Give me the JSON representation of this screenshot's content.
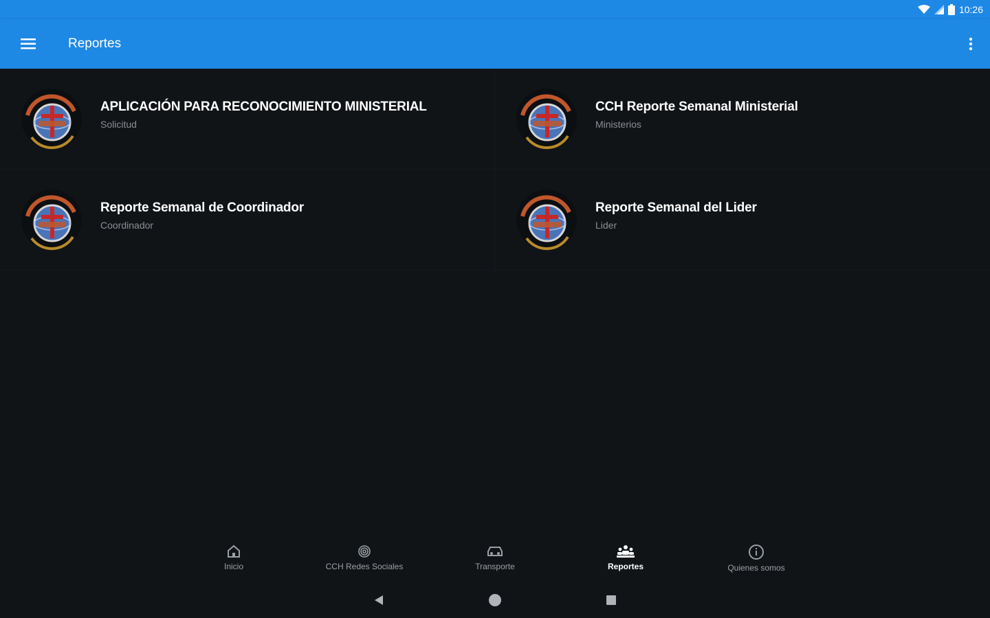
{
  "status_bar": {
    "time": "10:26"
  },
  "app_bar": {
    "title": "Reportes"
  },
  "cards": [
    {
      "title": "APLICACIÓN PARA RECONOCIMIENTO MINISTERIAL",
      "subtitle": "Solicitud"
    },
    {
      "title": "CCH Reporte Semanal Ministerial",
      "subtitle": "Ministerios"
    },
    {
      "title": "Reporte Semanal de Coordinador",
      "subtitle": "Coordinador"
    },
    {
      "title": "Reporte Semanal del Lider",
      "subtitle": "Lider"
    }
  ],
  "bottom_nav": [
    {
      "label": "Inicio",
      "icon": "home-icon"
    },
    {
      "label": "CCH Redes Sociales",
      "icon": "fingerprint-icon"
    },
    {
      "label": "Transporte",
      "icon": "car-icon"
    },
    {
      "label": "Reportes",
      "icon": "groups-icon",
      "active": true
    },
    {
      "label": "Quienes somos",
      "icon": "info-icon"
    }
  ],
  "colors": {
    "primary": "#1e88e5",
    "background": "#111417",
    "subtitle": "#8a8f93"
  }
}
